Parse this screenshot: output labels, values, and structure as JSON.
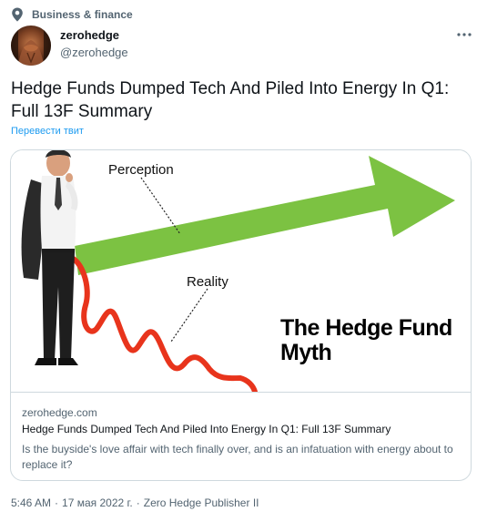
{
  "context": {
    "icon": "location-pin-icon",
    "label": "Business & finance"
  },
  "author": {
    "name": "zerohedge",
    "handle": "@zerohedge",
    "avatar": "avatar"
  },
  "more_icon": "more-horizontal-icon",
  "tweet": {
    "text": "Hedge Funds Dumped Tech And Piled Into Energy In Q1: Full 13F Summary",
    "translate_label": "Перевести твит"
  },
  "card": {
    "image_text": {
      "perception": "Perception",
      "reality": "Reality",
      "title_line1": "The Hedge Fund",
      "title_line2": "Myth"
    },
    "domain": "zerohedge.com",
    "title": "Hedge Funds Dumped Tech And Piled Into Energy In Q1: Full 13F Summary",
    "description": "Is the buyside's love affair with tech finally over, and is an infatuation with energy about to replace it?"
  },
  "meta": {
    "time": "5:46 AM",
    "separator1": "·",
    "date": "17 мая 2022 г.",
    "separator2": "·",
    "source": "Zero Hedge Publisher II"
  },
  "colors": {
    "accent": "#1d9bf0",
    "secondary_text": "#536471",
    "primary_text": "#0f1419",
    "border": "#cfd9de",
    "arrow_green": "#7cc242",
    "line_red": "#e8341c"
  }
}
